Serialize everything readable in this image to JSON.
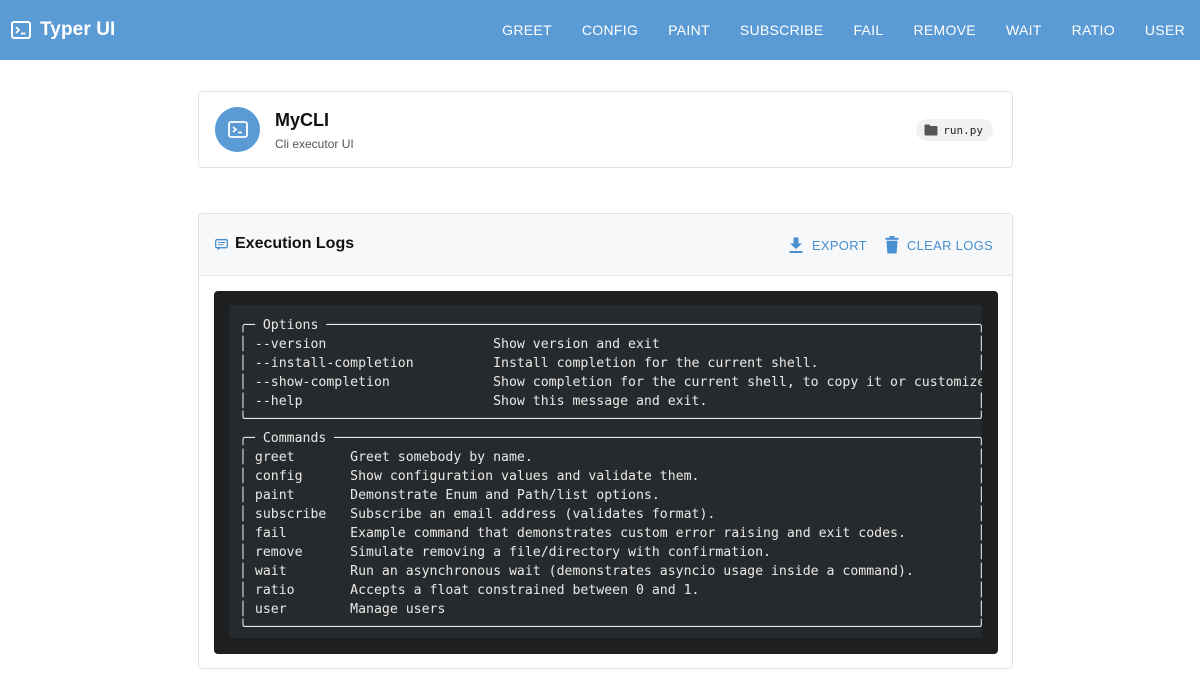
{
  "app": {
    "brand_title": "Typer UI",
    "nav": [
      "GREET",
      "CONFIG",
      "PAINT",
      "SUBSCRIBE",
      "FAIL",
      "REMOVE",
      "WAIT",
      "RATIO",
      "USER"
    ]
  },
  "header_card": {
    "name": "MyCLI",
    "subtitle": "Cli executor UI",
    "file": "run.py",
    "icon": "terminal-icon",
    "file_icon": "folder-icon"
  },
  "logs": {
    "title": "Execution Logs",
    "title_icon": "message-icon",
    "export_label": "EXPORT",
    "export_icon": "download-icon",
    "clear_label": "CLEAR LOGS",
    "clear_icon": "trash-icon",
    "terminal_lines": [
      "",
      "╭─ Options ──────────────────────────────────────────────────────────────────────────────────╮",
      "│ --version                     Show version and exit                                        │",
      "│ --install-completion          Install completion for the current shell.                    │",
      "│ --show-completion             Show completion for the current shell, to copy it or customize the installation. │",
      "│ --help                        Show this message and exit.                                  │",
      "╰────────────────────────────────────────────────────────────────────────────────────────────╯",
      "╭─ Commands ─────────────────────────────────────────────────────────────────────────────────╮",
      "│ greet       Greet somebody by name.                                                        │",
      "│ config      Show configuration values and validate them.                                   │",
      "│ paint       Demonstrate Enum and Path/list options.                                        │",
      "│ subscribe   Subscribe an email address (validates format).                                 │",
      "│ fail        Example command that demonstrates custom error raising and exit codes.         │",
      "│ remove      Simulate removing a file/directory with confirmation.                          │",
      "│ wait        Run an asynchronous wait (demonstrates asyncio usage inside a command).        │",
      "│ ratio       Accepts a float constrained between 0 and 1.                                   │",
      "│ user        Manage users                                                                   │",
      "╰────────────────────────────────────────────────────────────────────────────────────────────╯"
    ]
  },
  "colors": {
    "primary": "#5b9bd5",
    "action_text": "#4a8fd0",
    "terminal_bg": "#1d1f21",
    "terminal_inner_bg": "#272a2c"
  }
}
